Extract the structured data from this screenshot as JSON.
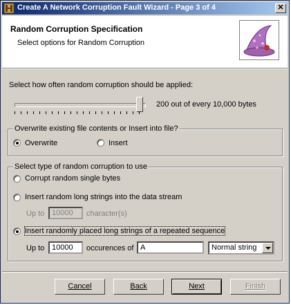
{
  "window": {
    "title": "Create A Network Corruption Fault Wizard - Page 3 of 4"
  },
  "header": {
    "title": "Random Corruption Specification",
    "subtitle": "Select options for Random Corruption"
  },
  "frequency": {
    "prompt": "Select how often random corruption should be applied:",
    "slider_value": 200,
    "slider_max": 10000,
    "readout": "200 out of every 10,000 bytes"
  },
  "write_mode": {
    "group_label": "Overwrite existing file contents or Insert into file?",
    "options": [
      {
        "label": "Overwrite",
        "selected": true
      },
      {
        "label": "Insert",
        "selected": false
      }
    ]
  },
  "corruption_type": {
    "group_label": "Select type of random corruption to use",
    "option_single": "Corrupt random single bytes",
    "option_long": "Insert random long strings into the data stream",
    "long_up_to_label": "Up to",
    "long_count_value": "10000",
    "long_unit_label": "character(s)",
    "option_repeated": "Insert randomly placed long strings of a repeated sequence",
    "selected_option": "repeated",
    "repeated_up_to_label": "Up to",
    "repeated_count_value": "10000",
    "occurences_label": "occurences of",
    "sequence_value": "A",
    "string_type_selected": "Normal string"
  },
  "buttons": {
    "cancel": "Cancel",
    "back": "Back",
    "next": "Next",
    "finish": "Finish"
  }
}
